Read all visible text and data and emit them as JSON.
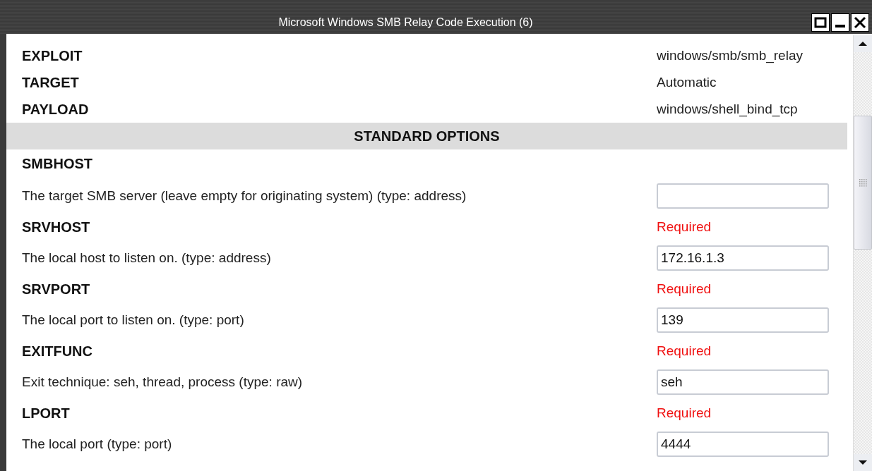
{
  "window": {
    "title": "Microsoft Windows SMB Relay Code Execution (6)"
  },
  "configuration": [
    {
      "label": "EXPLOIT",
      "value": "windows/smb/smb_relay"
    },
    {
      "label": "TARGET",
      "value": "Automatic"
    },
    {
      "label": "PAYLOAD",
      "value": "windows/shell_bind_tcp"
    }
  ],
  "section_title": "STANDARD OPTIONS",
  "options": [
    {
      "name": "SMBHOST",
      "description": "The target SMB server (leave empty for originating system) (type: address)"
    },
    {
      "name": "SRVHOST",
      "required_label": "Required",
      "description": "The local host to listen on. (type: address)",
      "value": "172.16.1.3"
    },
    {
      "name": "SRVPORT",
      "required_label": "Required",
      "description": "The local port to listen on. (type: port)",
      "value": "139"
    },
    {
      "name": "EXITFUNC",
      "required_label": "Required",
      "description": "Exit technique: seh, thread, process (type: raw)",
      "value": "seh"
    },
    {
      "name": "LPORT",
      "required_label": "Required",
      "description": "The local port (type: port)",
      "value": "4444"
    }
  ]
}
